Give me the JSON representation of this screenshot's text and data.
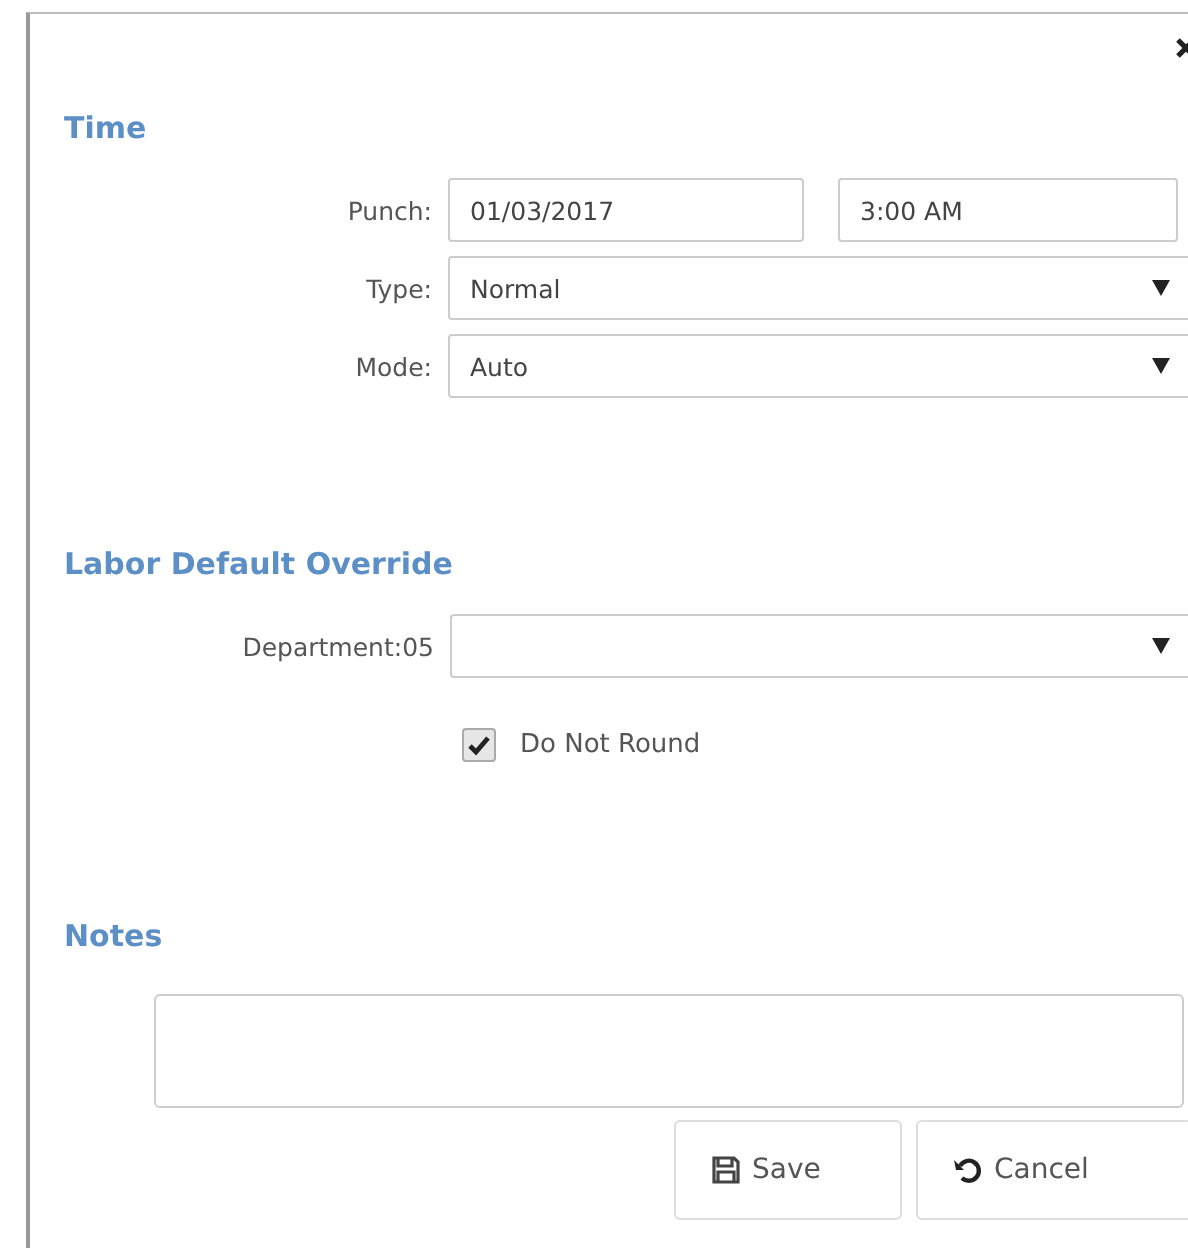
{
  "sections": [
    {
      "title": "Time",
      "fields": [
        {
          "kind": "pair",
          "label": "Punch:",
          "values": [
            "01/03/2017",
            "3:00 AM"
          ]
        },
        {
          "kind": "select",
          "label": "Type:",
          "value": "Normal"
        },
        {
          "kind": "select",
          "label": "Mode:",
          "value": "Auto"
        }
      ]
    },
    {
      "title": "Labor Default Override",
      "fields": [
        {
          "kind": "select",
          "label": "Department:05"
        },
        {
          "kind": "checkbox",
          "label": "Do Not Round",
          "checked": true
        }
      ]
    },
    {
      "title": "Notes",
      "fields": [
        {
          "kind": "textarea"
        }
      ]
    }
  ],
  "buttons": [
    {
      "kind": "save",
      "label": "Save"
    },
    {
      "kind": "cancel",
      "label": "Cancel"
    }
  ]
}
